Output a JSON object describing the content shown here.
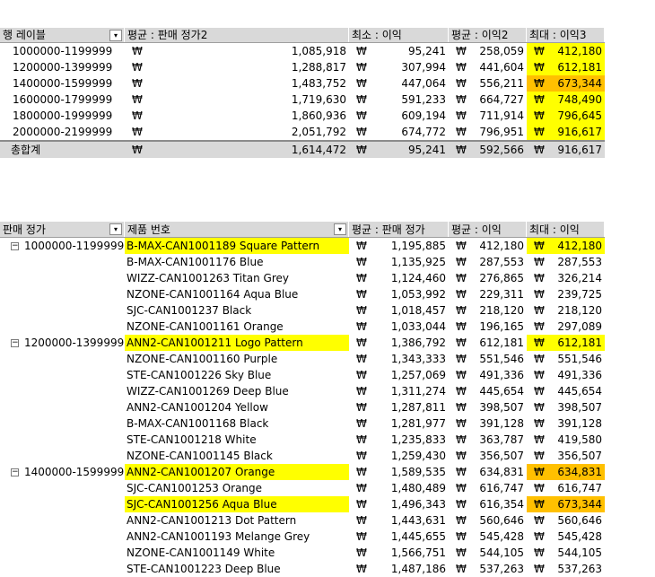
{
  "top_table": {
    "headers": [
      "행 레이블",
      "평균 : 판매 정가2",
      "최소 : 이익",
      "평균 : 이익2",
      "최대 : 이익3"
    ],
    "currency": "₩",
    "rows": [
      {
        "label": "1000000-1199999",
        "avg_price": "1,085,918",
        "min_profit": "95,241",
        "avg_profit": "258,059",
        "max_profit": "412,180"
      },
      {
        "label": "1200000-1399999",
        "avg_price": "1,288,817",
        "min_profit": "307,994",
        "avg_profit": "441,604",
        "max_profit": "612,181"
      },
      {
        "label": "1400000-1599999",
        "avg_price": "1,483,752",
        "min_profit": "447,064",
        "avg_profit": "556,211",
        "max_profit": "673,344"
      },
      {
        "label": "1600000-1799999",
        "avg_price": "1,719,630",
        "min_profit": "591,233",
        "avg_profit": "664,727",
        "max_profit": "748,490"
      },
      {
        "label": "1800000-1999999",
        "avg_price": "1,860,936",
        "min_profit": "609,194",
        "avg_profit": "711,914",
        "max_profit": "796,645"
      },
      {
        "label": "2000000-2199999",
        "avg_price": "2,051,792",
        "min_profit": "674,772",
        "avg_profit": "796,951",
        "max_profit": "916,617"
      }
    ],
    "total": {
      "label": "총합계",
      "avg_price": "1,614,472",
      "min_profit": "95,241",
      "avg_profit": "592,566",
      "max_profit": "916,617"
    }
  },
  "bottom_table": {
    "headers": [
      "판매 정가",
      "제품 번호",
      "평균 : 판매 정가",
      "평균 : 이익",
      "최대 : 이익"
    ],
    "currency": "₩",
    "rows": [
      {
        "group": "1000000-1199999",
        "product": "B-MAX-CAN1001189 Square Pattern",
        "avg_price": "1,195,885",
        "avg_profit": "412,180",
        "max_profit": "412,180"
      },
      {
        "group": "",
        "product": "B-MAX-CAN1001176 Blue",
        "avg_price": "1,135,925",
        "avg_profit": "287,553",
        "max_profit": "287,553"
      },
      {
        "group": "",
        "product": "WIZZ-CAN1001263 Titan Grey",
        "avg_price": "1,124,460",
        "avg_profit": "276,865",
        "max_profit": "326,214"
      },
      {
        "group": "",
        "product": "NZONE-CAN1001164 Aqua Blue",
        "avg_price": "1,053,992",
        "avg_profit": "229,311",
        "max_profit": "239,725"
      },
      {
        "group": "",
        "product": "SJC-CAN1001237 Black",
        "avg_price": "1,018,457",
        "avg_profit": "218,120",
        "max_profit": "218,120"
      },
      {
        "group": "",
        "product": "NZONE-CAN1001161 Orange",
        "avg_price": "1,033,044",
        "avg_profit": "196,165",
        "max_profit": "297,089"
      },
      {
        "group": "1200000-1399999",
        "product": "ANN2-CAN1001211 Logo Pattern",
        "avg_price": "1,386,792",
        "avg_profit": "612,181",
        "max_profit": "612,181"
      },
      {
        "group": "",
        "product": "NZONE-CAN1001160 Purple",
        "avg_price": "1,343,333",
        "avg_profit": "551,546",
        "max_profit": "551,546"
      },
      {
        "group": "",
        "product": "STE-CAN1001226 Sky Blue",
        "avg_price": "1,257,069",
        "avg_profit": "491,336",
        "max_profit": "491,336"
      },
      {
        "group": "",
        "product": "WIZZ-CAN1001269 Deep Blue",
        "avg_price": "1,311,274",
        "avg_profit": "445,654",
        "max_profit": "445,654"
      },
      {
        "group": "",
        "product": "ANN2-CAN1001204 Yellow",
        "avg_price": "1,287,811",
        "avg_profit": "398,507",
        "max_profit": "398,507"
      },
      {
        "group": "",
        "product": "B-MAX-CAN1001168 Black",
        "avg_price": "1,281,977",
        "avg_profit": "391,128",
        "max_profit": "391,128"
      },
      {
        "group": "",
        "product": "STE-CAN1001218 White",
        "avg_price": "1,235,833",
        "avg_profit": "363,787",
        "max_profit": "419,580"
      },
      {
        "group": "",
        "product": "NZONE-CAN1001145 Black",
        "avg_price": "1,259,430",
        "avg_profit": "356,507",
        "max_profit": "356,507"
      },
      {
        "group": "1400000-1599999",
        "product": "ANN2-CAN1001207 Orange",
        "avg_price": "1,589,535",
        "avg_profit": "634,831",
        "max_profit": "634,831"
      },
      {
        "group": "",
        "product": "SJC-CAN1001253 Orange",
        "avg_price": "1,480,489",
        "avg_profit": "616,747",
        "max_profit": "616,747"
      },
      {
        "group": "",
        "product": "SJC-CAN1001256 Aqua Blue",
        "avg_price": "1,496,343",
        "avg_profit": "616,354",
        "max_profit": "673,344"
      },
      {
        "group": "",
        "product": "ANN2-CAN1001213 Dot Pattern",
        "avg_price": "1,443,631",
        "avg_profit": "560,646",
        "max_profit": "560,646"
      },
      {
        "group": "",
        "product": "ANN2-CAN1001193 Melange Grey",
        "avg_price": "1,445,655",
        "avg_profit": "545,428",
        "max_profit": "545,428"
      },
      {
        "group": "",
        "product": "NZONE-CAN1001149 White",
        "avg_price": "1,566,751",
        "avg_profit": "544,105",
        "max_profit": "544,105"
      },
      {
        "group": "",
        "product": "STE-CAN1001223 Deep Blue",
        "avg_price": "1,487,186",
        "avg_profit": "537,263",
        "max_profit": "537,263"
      }
    ]
  },
  "colors": {
    "header_bg": "#d9d9d9",
    "highlight_yellow": "#ffff00",
    "highlight_orange": "#ffc000"
  }
}
